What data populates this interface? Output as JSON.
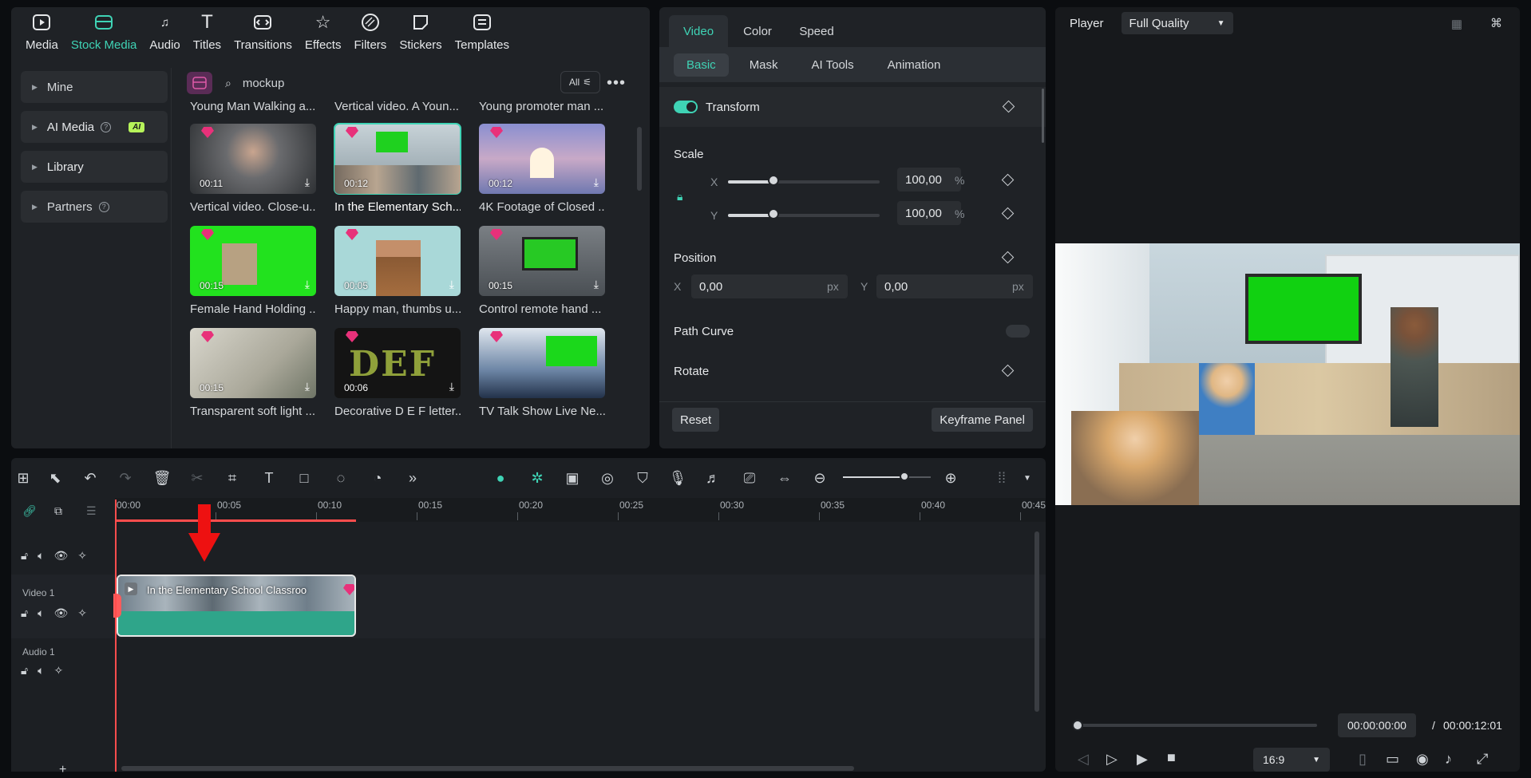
{
  "media": {
    "tabs": [
      {
        "label": "Media",
        "icon": "media-icon"
      },
      {
        "label": "Stock Media",
        "icon": "stock-media-icon",
        "active": true
      },
      {
        "label": "Audio",
        "icon": "audio-icon"
      },
      {
        "label": "Titles",
        "icon": "titles-icon"
      },
      {
        "label": "Transitions",
        "icon": "transitions-icon"
      },
      {
        "label": "Effects",
        "icon": "effects-icon"
      },
      {
        "label": "Filters",
        "icon": "filters-icon"
      },
      {
        "label": "Stickers",
        "icon": "stickers-icon"
      },
      {
        "label": "Templates",
        "icon": "templates-icon"
      }
    ],
    "sidebar": {
      "mine": "Mine",
      "ai_media": "AI Media",
      "ai_badge": "AI",
      "library": "Library",
      "partners": "Partners"
    },
    "search": {
      "value": "mockup",
      "filter_label": "All"
    },
    "items": [
      {
        "caption": "Young Man Walking a...",
        "duration": "",
        "premium": false
      },
      {
        "caption": "Vertical video. A Youn...",
        "duration": "",
        "premium": false
      },
      {
        "caption": "Young promoter man ...",
        "duration": "",
        "premium": false
      },
      {
        "caption": "Vertical video. Close-u...",
        "duration": "00:11",
        "premium": true
      },
      {
        "caption": "In the Elementary Sch...",
        "duration": "00:12",
        "premium": true,
        "selected": true
      },
      {
        "caption": "4K Footage of Closed ...",
        "duration": "00:12",
        "premium": true
      },
      {
        "caption": "Female Hand Holding ...",
        "duration": "00:15",
        "premium": true
      },
      {
        "caption": "Happy man, thumbs u...",
        "duration": "00:05",
        "premium": true
      },
      {
        "caption": "Control remote hand ...",
        "duration": "00:15",
        "premium": true
      },
      {
        "caption": "Transparent soft light ...",
        "duration": "00:15",
        "premium": true
      },
      {
        "caption": "Decorative D E F letter...",
        "duration": "00:06",
        "premium": true
      },
      {
        "caption": "TV Talk Show Live Ne...",
        "duration": "",
        "premium": true
      }
    ],
    "def_text": "DEF"
  },
  "props": {
    "tabs": [
      "Video",
      "Color",
      "Speed"
    ],
    "subtabs": [
      "Basic",
      "Mask",
      "AI Tools",
      "Animation"
    ],
    "transform": "Transform",
    "scale": {
      "label": "Scale",
      "x_label": "X",
      "y_label": "Y",
      "x_value": "100,00",
      "y_value": "100,00",
      "unit": "%",
      "x_level": 0.3,
      "y_level": 0.3
    },
    "position": {
      "label": "Position",
      "x_label": "X",
      "y_label": "Y",
      "x_value": "0,00",
      "y_value": "0,00",
      "unit": "px"
    },
    "path_curve": "Path Curve",
    "rotate": "Rotate",
    "reset": "Reset",
    "keyframe_panel": "Keyframe Panel"
  },
  "timeline": {
    "ruler": [
      "00:00",
      "00:05",
      "00:10",
      "00:15",
      "00:20",
      "00:25",
      "00:30",
      "00:35",
      "00:40",
      "00:45"
    ],
    "video_track": "Video 1",
    "audio_track": "Audio 1",
    "clip_title": "In the Elementary School Classroo",
    "add_track": "+",
    "zoom_level": 0.7
  },
  "player": {
    "label": "Player",
    "quality": "Full Quality",
    "current_time": "00:00:00:00",
    "separator": "/",
    "total_time": "00:00:12:01",
    "aspect": "16:9",
    "progress": 0
  },
  "colors": {
    "accent": "#3fd3b5",
    "playhead": "#ff4d4d",
    "premium": "#e8317a"
  }
}
